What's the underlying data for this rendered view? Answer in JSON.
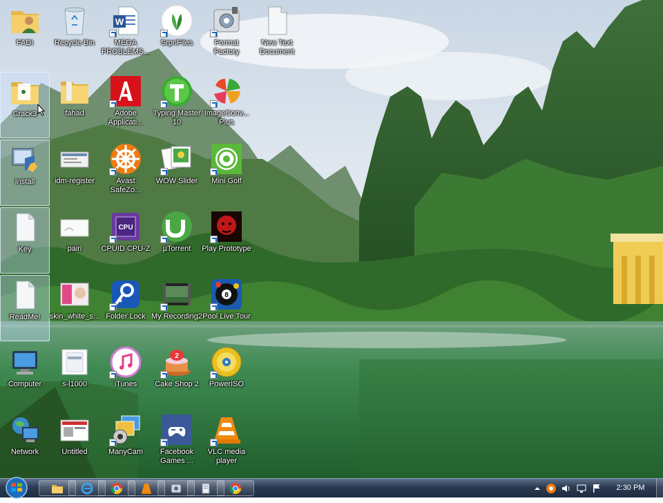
{
  "desktop": {
    "icons": [
      {
        "label": "FADI"
      },
      {
        "label": "Recycle Bin"
      },
      {
        "label": "MEGA PROBLEMS..."
      },
      {
        "label": "SrpnFiles"
      },
      {
        "label": "Format Factory"
      },
      {
        "label": "New Text Document"
      },
      {
        "label": "Crack3"
      },
      {
        "label": "fahad"
      },
      {
        "label": "Adobe Applicati..."
      },
      {
        "label": "Typing Master 10"
      },
      {
        "label": "ImageConv... Plus"
      },
      {
        "label": "Install"
      },
      {
        "label": "idm-register"
      },
      {
        "label": "Avast SafeZo..."
      },
      {
        "label": "WOW Slider"
      },
      {
        "label": "Mini Golf"
      },
      {
        "label": "Key"
      },
      {
        "label": "pairi"
      },
      {
        "label": "CPUID CPU-Z"
      },
      {
        "label": "µTorrent"
      },
      {
        "label": "Play Prototype"
      },
      {
        "label": "ReadMe!"
      },
      {
        "label": "skin_white_s..."
      },
      {
        "label": "Folder Lock"
      },
      {
        "label": "My Recording2"
      },
      {
        "label": "Pool Live Tour"
      },
      {
        "label": "Computer"
      },
      {
        "label": "s-l1000"
      },
      {
        "label": "iTunes"
      },
      {
        "label": "Cake Shop 2"
      },
      {
        "label": "PowerISO"
      },
      {
        "label": "Network"
      },
      {
        "label": "Untitled"
      },
      {
        "label": "ManyCam"
      },
      {
        "label": "Facebook Games ..."
      },
      {
        "label": "VLC media player"
      }
    ]
  },
  "taskbar": {
    "pinned": [
      "explorer-icon",
      "internet-explorer-icon",
      "chrome-icon",
      "vlc-icon",
      "settings-app-icon",
      "notepad-icon",
      "chrome-icon"
    ],
    "clock": "2:30 PM"
  }
}
